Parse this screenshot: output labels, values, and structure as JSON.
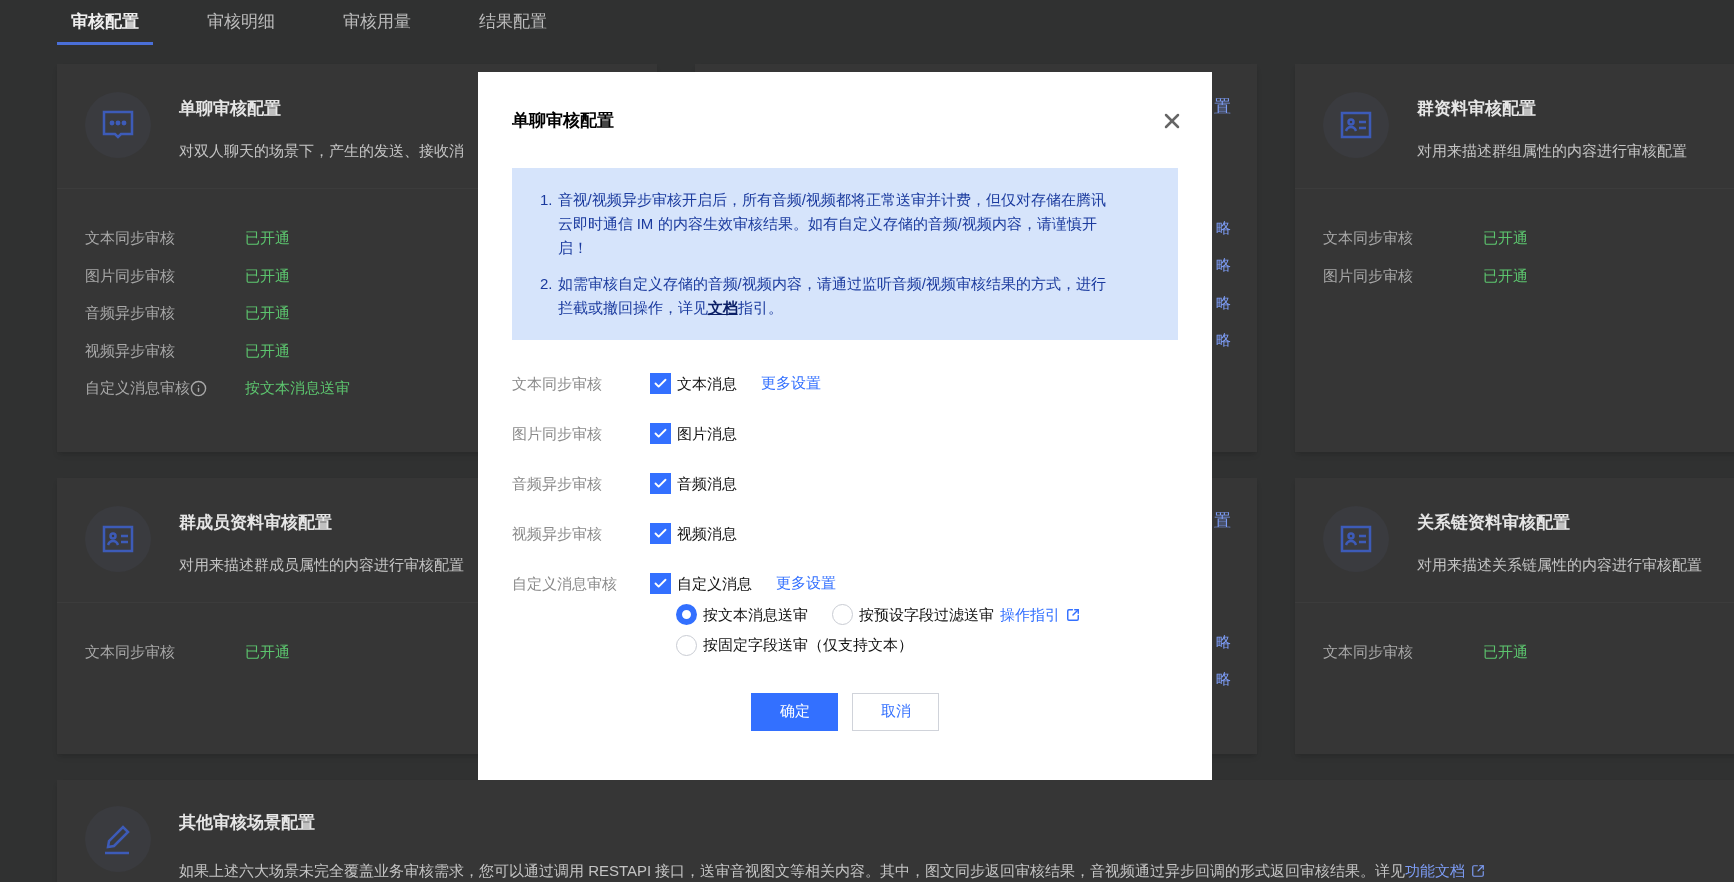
{
  "tabs": [
    {
      "label": "审核配置",
      "selected": true
    },
    {
      "label": "审核明细",
      "selected": false
    },
    {
      "label": "审核用量",
      "selected": false
    },
    {
      "label": "结果配置",
      "selected": false
    }
  ],
  "cards": [
    {
      "kind": "chat",
      "title": "单聊审核配置",
      "description": "对双人聊天的场景下，产生的发送、接收消",
      "rows": [
        {
          "label": "文本同步审核",
          "info_icon": false,
          "status": "已开通"
        },
        {
          "label": "图片同步审核",
          "info_icon": false,
          "status": "已开通"
        },
        {
          "label": "音频异步审核",
          "info_icon": false,
          "status": "已开通"
        },
        {
          "label": "视频异步审核",
          "info_icon": false,
          "status": "已开通"
        },
        {
          "label": "自定义消息审核",
          "info_icon": true,
          "status": "按文本消息送审"
        }
      ]
    },
    {
      "kind": "clipped",
      "title": "置",
      "links": [
        "略",
        "略",
        "略",
        "略"
      ]
    },
    {
      "kind": "profile",
      "title": "群资料审核配置",
      "description": "对用来描述群组属性的内容进行审核配置",
      "rows": [
        {
          "label": "文本同步审核",
          "info_icon": false,
          "status": "已开通"
        },
        {
          "label": "图片同步审核",
          "info_icon": false,
          "status": "已开通"
        }
      ]
    },
    {
      "kind": "profile",
      "title": "群成员资料审核配置",
      "description": "对用来描述群成员属性的内容进行审核配置",
      "rows": [
        {
          "label": "文本同步审核",
          "info_icon": false,
          "status": "已开通"
        }
      ]
    },
    {
      "kind": "clipped",
      "title": "置",
      "links": [
        "略",
        "略"
      ]
    },
    {
      "kind": "profile",
      "title": "关系链资料审核配置",
      "description": "对用来描述关系链属性的内容进行审核配置",
      "rows": [
        {
          "label": "文本同步审核",
          "info_icon": false,
          "status": "已开通"
        }
      ]
    },
    {
      "kind": "other",
      "title": "其他审核场景配置",
      "description": "如果上述六大场景未完全覆盖业务审核需求，您可以通过调用 RESTAPI 接口，送审音视图文等相关内容。其中，图文同步返回审核结果，音视频通过异步回调的形式返回审核结果。详见",
      "link": "功能文档"
    }
  ],
  "modal": {
    "title": "单聊审核配置",
    "notices": [
      {
        "number": "1.",
        "text": "音视/视频异步审核开启后，所有音频/视频都将正常送审并计费，但仅对存储在腾讯云即时通信 IM 的内容生效审核结果。如有自定义存储的音频/视频内容，请谨慎开启！"
      },
      {
        "number": "2.",
        "text": "如需审核自定义存储的音频/视频内容，请通过监听音频/视频审核结果的方式，进行拦截或撤回操作，详见",
        "link": "文档",
        "after": "指引。"
      }
    ],
    "rows": [
      {
        "label": "文本同步审核",
        "option": "文本消息",
        "checked": true,
        "more": "更多设置"
      },
      {
        "label": "图片同步审核",
        "option": "图片消息",
        "checked": true
      },
      {
        "label": "音频异步审核",
        "option": "音频消息",
        "checked": true
      },
      {
        "label": "视频异步审核",
        "option": "视频消息",
        "checked": true
      },
      {
        "label": "自定义消息审核",
        "option": "自定义消息",
        "checked": true,
        "more": "更多设置",
        "radios": [
          {
            "label": "按文本消息送审",
            "selected": true
          },
          {
            "label": "按预设字段过滤送审",
            "selected": false,
            "link": "操作指引"
          },
          {
            "label": "按固定字段送审（仅支持文本）",
            "selected": false
          }
        ]
      }
    ],
    "buttons": [
      {
        "kind": "primary",
        "label": "确定"
      },
      {
        "kind": "secondary",
        "label": "取消"
      }
    ]
  }
}
